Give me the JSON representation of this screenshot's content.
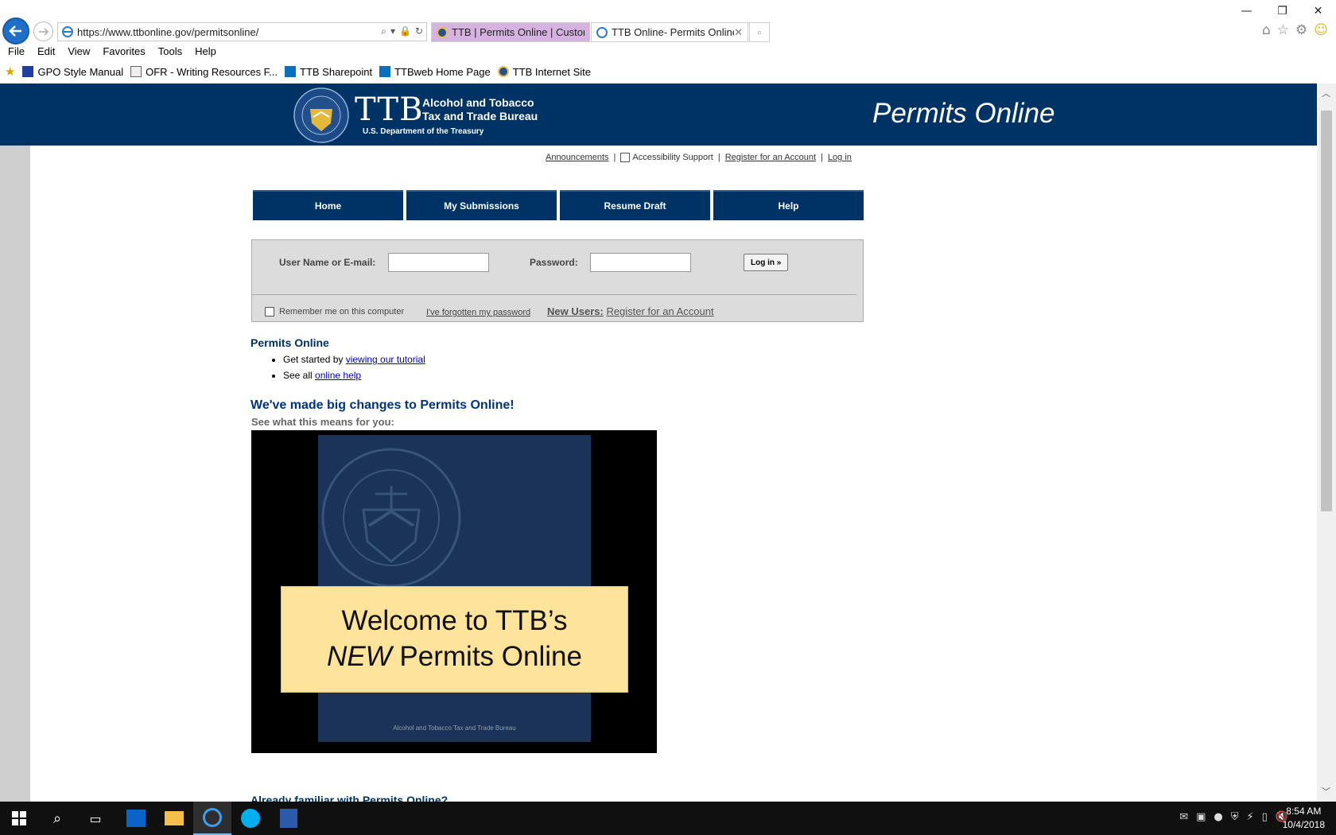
{
  "browser": {
    "url": "https://www.ttbonline.gov/permitsonline/",
    "tabs": [
      {
        "label": "TTB | Permits Online | Custom..."
      },
      {
        "label": "TTB Online- Permits Online..."
      }
    ],
    "menu": [
      "File",
      "Edit",
      "View",
      "Favorites",
      "Tools",
      "Help"
    ],
    "favorites": [
      {
        "label": "GPO Style Manual",
        "icon": "gpo-icon"
      },
      {
        "label": "OFR - Writing Resources F...",
        "icon": "page-icon"
      },
      {
        "label": "TTB Sharepoint",
        "icon": "sharepoint-icon"
      },
      {
        "label": "TTBweb Home Page",
        "icon": "sharepoint-icon"
      },
      {
        "label": "TTB Internet Site",
        "icon": "ttb-seal-icon"
      }
    ]
  },
  "header": {
    "logo_letters": "TTB",
    "agency_line1": "Alcohol and Tobacco",
    "agency_line2": "Tax and Trade Bureau",
    "department": "U.S. Department of the Treasury",
    "site_title": "Permits Online",
    "color": "#003365"
  },
  "utility_links": {
    "announcements": "Announcements",
    "accessibility": "Accessibility Support",
    "register": "Register for an Account",
    "login": "Log in"
  },
  "nav": [
    {
      "label": "Home"
    },
    {
      "label": "My Submissions"
    },
    {
      "label": "Resume Draft"
    },
    {
      "label": "Help"
    }
  ],
  "login": {
    "username_label": "User Name or E-mail:",
    "username_value": "",
    "password_label": "Password:",
    "password_value": "",
    "button": "Log in »",
    "remember": "Remember me on this computer",
    "forgot": "I've forgotten my password",
    "new_users_label": "New Users:",
    "new_users_link": "Register for an Account"
  },
  "permits_online": {
    "heading": "Permits Online",
    "item1_prefix": "Get started by ",
    "item1_link": "viewing our tutorial",
    "item2_prefix": "See all ",
    "item2_link": "online help"
  },
  "changes": {
    "heading": "We've made big changes to Permits Online!",
    "subheading": "See what this means for you:",
    "video_title_line1": "Welcome to TTB’s",
    "video_title_new": "NEW",
    "video_title_line2_rest": " Permits Online",
    "video_caption": "Alcohol and Tobacco Tax and Trade Bureau"
  },
  "already_familiar": "Already familiar with Permits Online?",
  "taskbar": {
    "time": "8:54 AM",
    "date": "10/4/2018"
  }
}
